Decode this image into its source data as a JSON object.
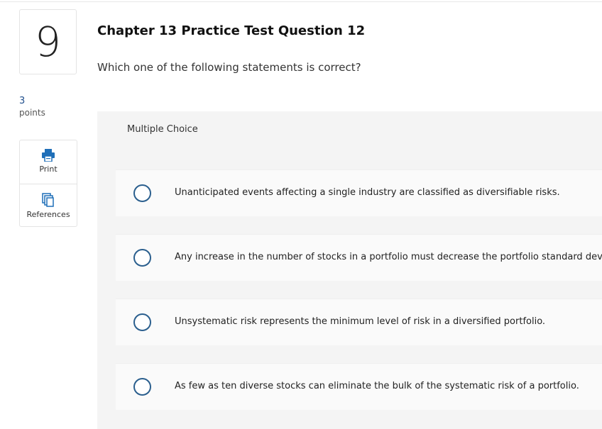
{
  "question": {
    "number": "9",
    "points_value": "3",
    "points_label": "points",
    "title": "Chapter 13 Practice Test Question 12",
    "prompt": "Which one of the following statements is correct?",
    "type_label": "Multiple Choice"
  },
  "tools": {
    "print_label": "Print",
    "references_label": "References"
  },
  "choices": [
    {
      "text": "Unanticipated events affecting a single industry are classified as diversifiable risks.",
      "selected": false
    },
    {
      "text": "Any increase in the number of stocks in a portfolio must decrease the portfolio standard deviation.",
      "selected": false
    },
    {
      "text": "Unsystematic risk represents the minimum level of risk in a diversified portfolio.",
      "selected": false
    },
    {
      "text": "As few as ten diverse stocks can eliminate the bulk of the systematic risk of a portfolio.",
      "selected": false
    }
  ],
  "colors": {
    "accent": "#2b5f8e",
    "panel_bg": "#f4f4f4",
    "print_icon": "#1f6fb8"
  },
  "icons": [
    "printer-icon",
    "copy-pages-icon",
    "radio-circle"
  ]
}
